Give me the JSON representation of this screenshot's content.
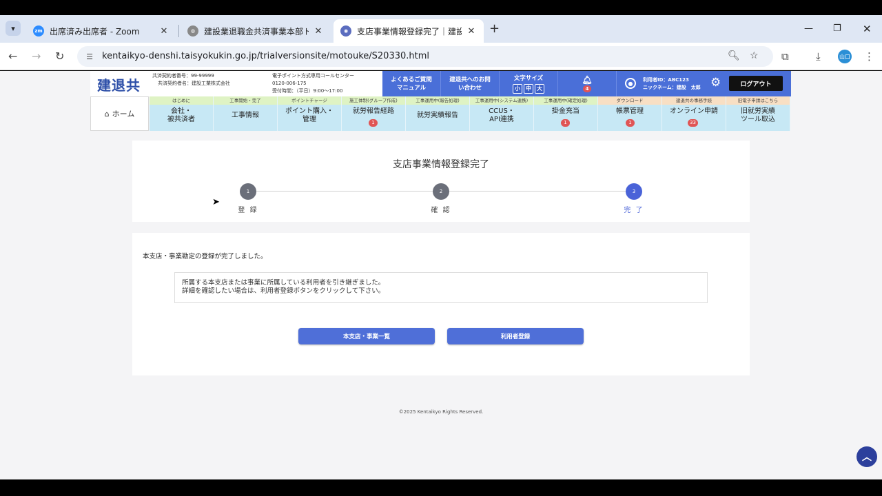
{
  "browser": {
    "tabs": [
      {
        "title": "出席済み出席者 - Zoom",
        "icon": "zoom-icon"
      },
      {
        "title": "建設業退職金共済事業本部トッ",
        "icon": "globe-icon"
      },
      {
        "title": "支店事業情報登録完了｜建設業",
        "icon": "site-favicon-icon"
      }
    ],
    "new_tab": "+",
    "url": "kentaikyo-denshi.taisyokukin.go.jp/trialversionsite/motouke/S20330.html",
    "profile_initials": "山口"
  },
  "site": {
    "logo": "建退共",
    "contract_no": "共済契約者番号：99-99999",
    "contract_name": "共済契約者名：建設工業株式会社",
    "callcenter_title": "電子ポイント方式専用コールセンター",
    "callcenter_phone": "0120-006-175",
    "callcenter_hours": "受付時間：（平日）9:00～17:00",
    "faq_line1": "よくあるご質問",
    "faq_line2": "マニュアル",
    "contact_line1": "建退共へのお問",
    "contact_line2": "い合わせ",
    "font_size_label": "文字サイズ",
    "font_sizes": [
      "小",
      "中",
      "大"
    ],
    "bell_count": "4",
    "user_id": "利用者ID：ABC123",
    "nickname": "ニックネーム：建設　太郎",
    "logout": "ログアウト",
    "home": "ホーム"
  },
  "nav": [
    {
      "sub": "はじめに",
      "label1": "会社・",
      "label2": "被共済者",
      "badge": ""
    },
    {
      "sub": "工事開始・完了",
      "label1": "工事情報",
      "label2": "",
      "badge": ""
    },
    {
      "sub": "ポイントチャージ",
      "label1": "ポイント購入・",
      "label2": "管理",
      "badge": ""
    },
    {
      "sub": "施工体制(グループ作成)",
      "label1": "就労報告経路",
      "label2": "",
      "badge": "1"
    },
    {
      "sub": "工事運用中(報告処理)",
      "label1": "就労実績報告",
      "label2": "",
      "badge": ""
    },
    {
      "sub": "工事運用中(システム連携)",
      "label1": "CCUS・",
      "label2": "API連携",
      "badge": ""
    },
    {
      "sub": "工事運用中(確定処理)",
      "label1": "掛金充当",
      "label2": "",
      "badge": "1"
    },
    {
      "sub": "ダウンロード",
      "label1": "帳票管理",
      "label2": "",
      "badge": "1"
    },
    {
      "sub": "建退共の事務手続",
      "label1": "オンライン申請",
      "label2": "",
      "badge": "33"
    },
    {
      "sub": "旧電子申請はこちら",
      "label1": "旧就労実績",
      "label2": "ツール取込",
      "badge": ""
    }
  ],
  "main": {
    "title": "支店事業情報登録完了",
    "steps": [
      {
        "num": "1",
        "label": "登 録"
      },
      {
        "num": "2",
        "label": "確 認"
      },
      {
        "num": "3",
        "label": "完 了"
      }
    ],
    "done_message": "本支店・事業勘定の登録が完了しました。",
    "info_line1": "所属する本支店または事業に所属している利用者を引き継ぎました。",
    "info_line2": "詳細を確認したい場合は、利用者登録ボタンをクリックして下さい。",
    "btn_list": "本支店・事業一覧",
    "btn_user_reg": "利用者登録",
    "copyright": "©2025 Kentaikyo Rights Reserved."
  },
  "colors": {
    "header_blue": "#4a6fd8",
    "nav_bg": "#c7e8f5",
    "step_done": "#6b6f7a",
    "step_active": "#4a63d8",
    "badge_red": "#e05555"
  }
}
